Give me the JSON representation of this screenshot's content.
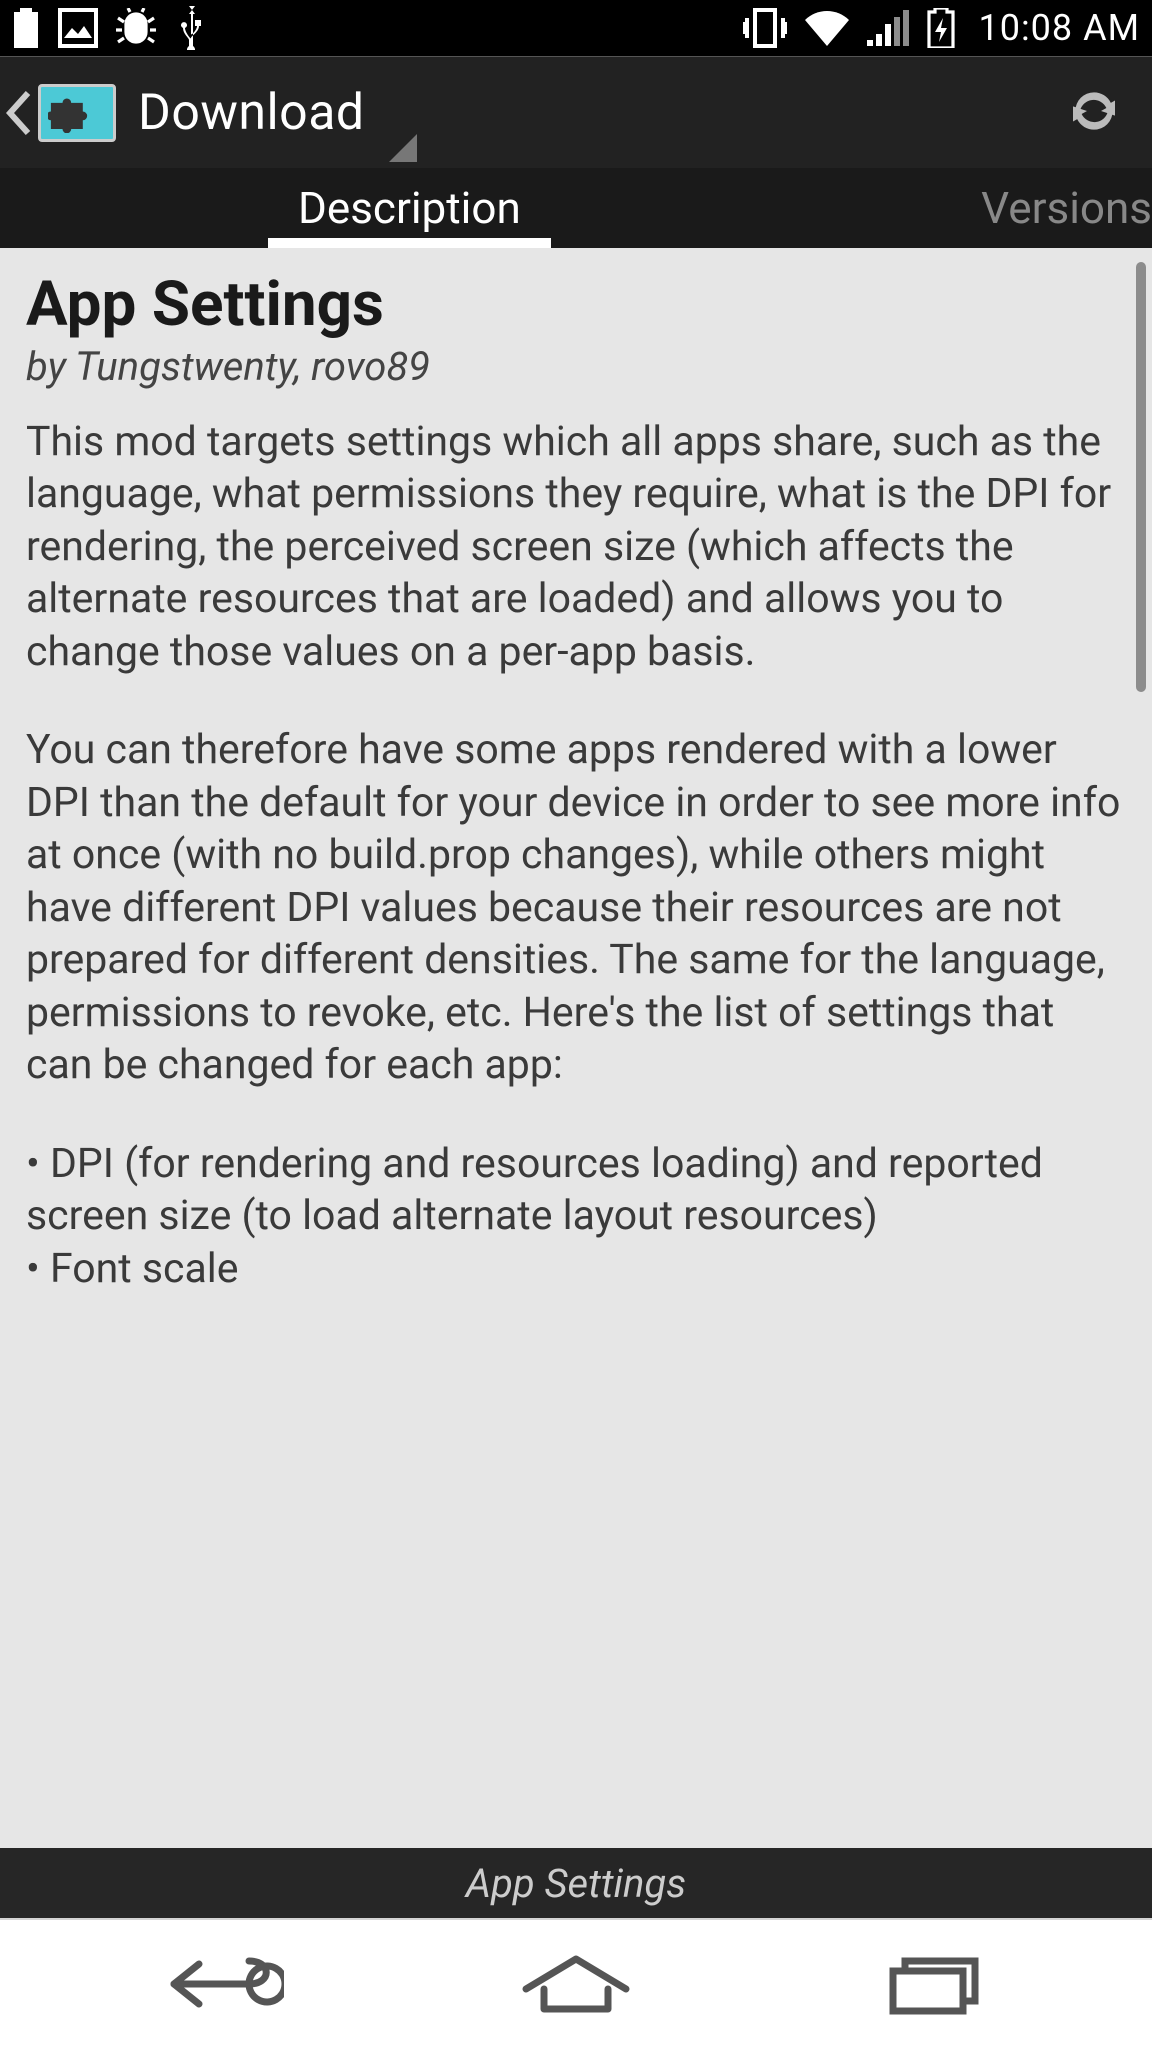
{
  "statusbar": {
    "time": "10:08 AM"
  },
  "actionbar": {
    "title": "Download"
  },
  "tabs": {
    "description": "Description",
    "versions": "Versions"
  },
  "module": {
    "title": "App Settings",
    "byline": "by Tungstwenty, rovo89",
    "para1": "This mod targets settings which all apps share, such as the language, what permissions they require, what is the DPI for rendering, the perceived screen size (which affects the alternate resources that are loaded) and allows you to change those values on a per-app basis.",
    "para2": "You can therefore have some apps rendered with a lower DPI than the default for your device in order to see more info at once (with no build.prop changes), while others might have different DPI values because their resources are not prepared for different densities. The same for the language, permissions to revoke, etc. Here's the list of settings that can be changed for each app:",
    "para3": " • DPI (for rendering and resources loading) and reported screen size (to load alternate layout resources)\n • Font scale"
  },
  "bottomContext": {
    "label": "App Settings"
  }
}
